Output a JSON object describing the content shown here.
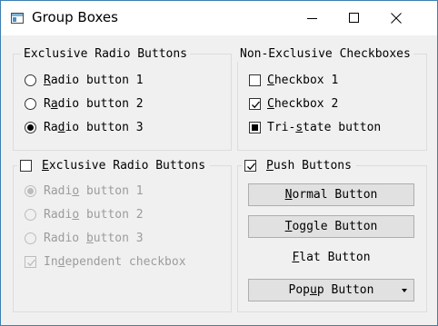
{
  "window": {
    "title": "Group Boxes",
    "icon": "app-window-icon"
  },
  "titlebar_buttons": {
    "minimize_icon": "minimize-icon",
    "maximize_icon": "maximize-icon",
    "close_icon": "close-icon"
  },
  "group_exclusive": {
    "title": "Exclusive Radio Buttons",
    "options": [
      {
        "pre": "",
        "key": "R",
        "post": "adio button 1",
        "checked": false
      },
      {
        "pre": "R",
        "key": "a",
        "post": "dio button 2",
        "checked": false
      },
      {
        "pre": "Ra",
        "key": "d",
        "post": "io button 3",
        "checked": true
      }
    ]
  },
  "group_nonexclusive": {
    "title": "Non-Exclusive Checkboxes",
    "options": [
      {
        "pre": "",
        "key": "C",
        "post": "heckbox 1",
        "state": "unchecked"
      },
      {
        "pre": "",
        "key": "C",
        "post": "heckbox 2",
        "state": "checked"
      },
      {
        "pre": "Tri-",
        "key": "s",
        "post": "tate button",
        "state": "partial"
      }
    ]
  },
  "group_checkable": {
    "title_pre": "",
    "title_key": "E",
    "title_post": "xclusive Radio Buttons",
    "checked": false,
    "options": [
      {
        "pre": "Radi",
        "key": "o",
        "post": " button 1",
        "checked": true
      },
      {
        "pre": "Radi",
        "key": "o",
        "post": " button 2",
        "checked": false
      },
      {
        "pre": "Radio ",
        "key": "b",
        "post": "utton 3",
        "checked": false
      }
    ],
    "independent": {
      "pre": "In",
      "key": "d",
      "post": "ependent checkbox",
      "checked": true
    }
  },
  "group_push": {
    "title_pre": "",
    "title_key": "P",
    "title_post": "ush Buttons",
    "checked": true,
    "normal": {
      "pre": "",
      "key": "N",
      "post": "ormal Button"
    },
    "toggle": {
      "pre": "",
      "key": "T",
      "post": "oggle Button"
    },
    "flat": {
      "pre": "",
      "key": "F",
      "post": "lat Button"
    },
    "popup": {
      "pre": "Pop",
      "key": "u",
      "post": "p Button"
    }
  },
  "colors": {
    "window_bg": "#f0f0f0",
    "titlebar_bg": "#ffffff",
    "window_border": "#3c7fb1",
    "button_bg": "#e1e1e1",
    "disabled_text": "#9c9c9c"
  }
}
